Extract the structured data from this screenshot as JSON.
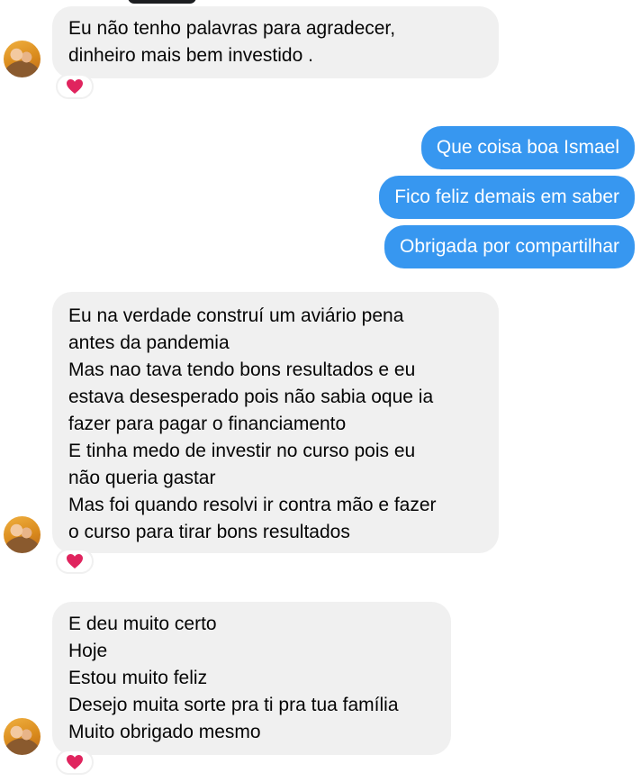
{
  "messages": {
    "m1": "Eu não tenho palavras para agradecer,\ndinheiro mais bem investido .",
    "out1": "Que coisa boa Ismael",
    "out2": "Fico feliz demais em saber",
    "out3": "Obrigada por compartilhar",
    "m2": "Eu na verdade construí um aviário pena\nantes da pandemia\nMas nao tava tendo bons resultados e eu\nestava desesperado pois não sabia oque ia\nfazer para pagar o financiamento\nE tinha medo de investir no curso pois eu\nnão queria gastar\nMas  foi quando resolvi ir contra mão e fazer\no curso para tirar bons resultados",
    "m3": "E deu muito certo\nHoje\nEstou muito feliz\nDesejo muita sorte pra ti pra tua família\nMuito obrigado mesmo"
  },
  "reaction_icon": "heart-icon",
  "colors": {
    "outgoing_bubble": "#3797f0",
    "incoming_bubble": "#f0f0f0",
    "heart": "#e0245e"
  }
}
